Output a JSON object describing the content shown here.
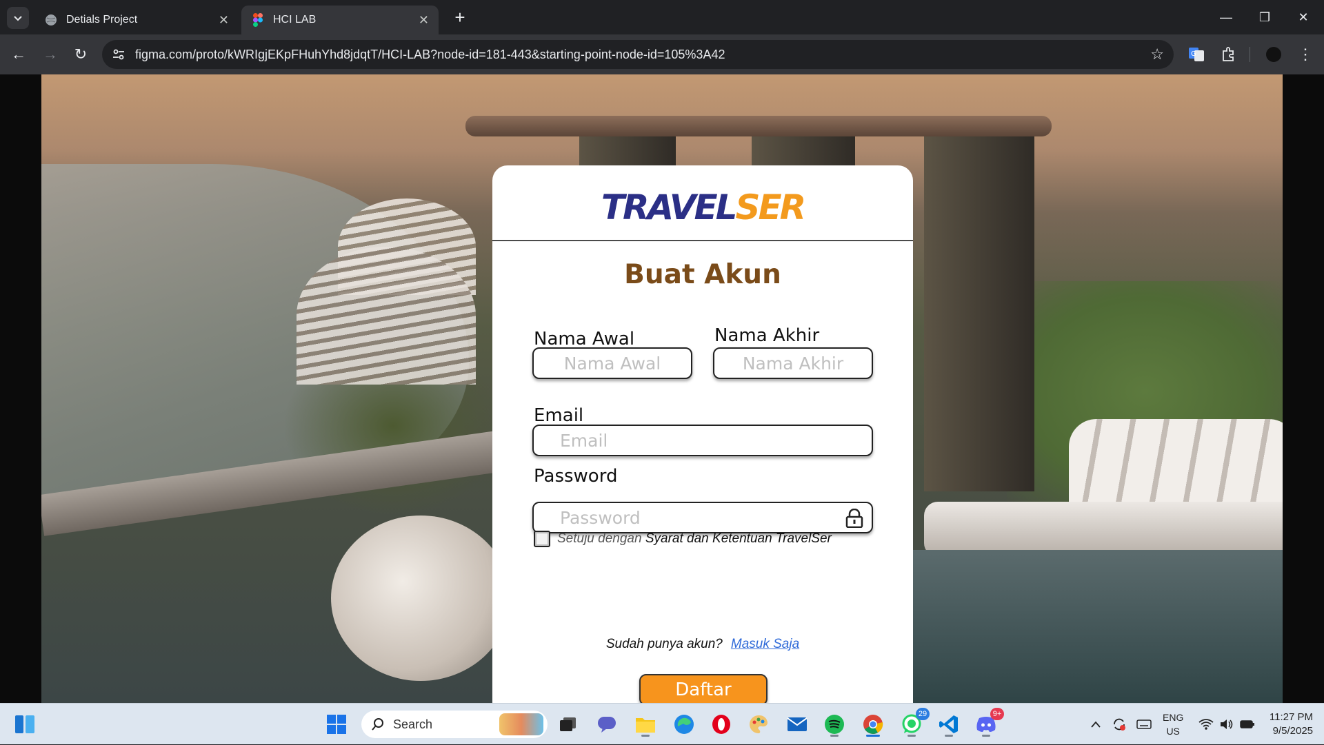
{
  "browser": {
    "tabs": [
      {
        "title": "Detials Project",
        "active": false
      },
      {
        "title": "HCI LAB",
        "active": true
      }
    ],
    "url": "figma.com/proto/kWRIgjEKpFHuhYhd8jdqtT/HCI-LAB?node-id=181-443&starting-point-node-id=105%3A42"
  },
  "app": {
    "logo": {
      "part1": "TRAVEL",
      "part2": "SER",
      "color1": "#2b2f86",
      "color2": "#f39a1d"
    },
    "title": "Buat Akun",
    "first_name": {
      "label": "Nama Awal",
      "placeholder": "Nama Awal",
      "value": ""
    },
    "last_name": {
      "label": "Nama Akhir",
      "placeholder": "Nama Akhir",
      "value": ""
    },
    "email": {
      "label": "Email",
      "placeholder": "Email",
      "value": ""
    },
    "password": {
      "label": "Password",
      "placeholder": "Password",
      "value": ""
    },
    "terms": {
      "prefix": "Setuju dengan ",
      "link": "Syarat dan Ketentuan TravelSer",
      "checked": false
    },
    "submit_label": "Daftar",
    "login_prompt": "Sudah punya akun?",
    "login_link": "Masuk Saja",
    "accent_color": "#f7941d",
    "title_color": "#7a4b19"
  },
  "taskbar": {
    "search_label": "Search",
    "whatsapp_badge": "29",
    "discord_badge": "9+",
    "lang_line1": "ENG",
    "lang_line2": "US",
    "time": "11:27 PM",
    "date": "9/5/2025"
  }
}
